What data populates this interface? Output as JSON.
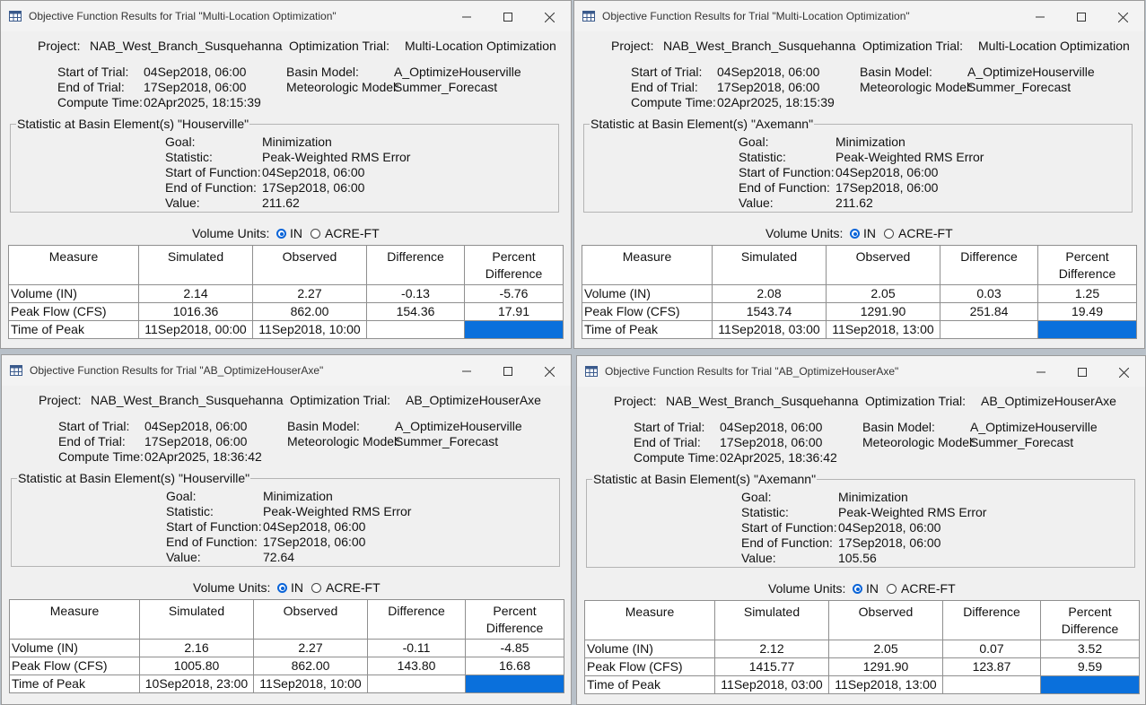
{
  "windows": [
    {
      "title": "Objective Function Results for Trial \"Multi-Location Optimization\"",
      "project_label": "Project:",
      "project": "NAB_West_Branch_Susquehanna",
      "trial_label": "Optimization Trial:",
      "trial": "Multi-Location Optimization",
      "start_label": "Start of Trial:",
      "start": "04Sep2018, 06:00",
      "end_label": "End of Trial:",
      "end": "17Sep2018, 06:00",
      "compute_label": "Compute Time:",
      "compute": "02Apr2025, 18:15:39",
      "basin_label": "Basin Model:",
      "basin": "A_OptimizeHouserville",
      "met_label": "Meteorologic Model:",
      "met": "Summer_Forecast",
      "group_title": "Statistic at Basin Element(s) \"Houserville\"",
      "goal_label": "Goal:",
      "goal": "Minimization",
      "statistic_label": "Statistic:",
      "statistic": "Peak-Weighted RMS Error",
      "fstart_label": "Start of Function:",
      "fstart": "04Sep2018, 06:00",
      "fend_label": "End of Function:",
      "fend": "17Sep2018, 06:00",
      "value_label": "Value:",
      "value": "211.62",
      "units_label": "Volume Units:",
      "unit_in": "IN",
      "unit_acre": "ACRE-FT",
      "headers": [
        "Measure",
        "Simulated",
        "Observed",
        "Difference",
        "Percent Difference"
      ],
      "rows": [
        [
          "Volume (IN)",
          "2.14",
          "2.27",
          "-0.13",
          "-5.76"
        ],
        [
          "Peak Flow (CFS)",
          "1016.36",
          "862.00",
          "154.36",
          "17.91"
        ],
        [
          "Time of Peak",
          "11Sep2018, 00:00",
          "11Sep2018, 10:00",
          "",
          ""
        ]
      ]
    },
    {
      "title": "Objective Function Results for Trial \"Multi-Location Optimization\"",
      "project_label": "Project:",
      "project": "NAB_West_Branch_Susquehanna",
      "trial_label": "Optimization Trial:",
      "trial": "Multi-Location Optimization",
      "start_label": "Start of Trial:",
      "start": "04Sep2018, 06:00",
      "end_label": "End of Trial:",
      "end": "17Sep2018, 06:00",
      "compute_label": "Compute Time:",
      "compute": "02Apr2025, 18:15:39",
      "basin_label": "Basin Model:",
      "basin": "A_OptimizeHouserville",
      "met_label": "Meteorologic Model:",
      "met": "Summer_Forecast",
      "group_title": "Statistic at Basin Element(s) \"Axemann\"",
      "goal_label": "Goal:",
      "goal": "Minimization",
      "statistic_label": "Statistic:",
      "statistic": "Peak-Weighted RMS Error",
      "fstart_label": "Start of Function:",
      "fstart": "04Sep2018, 06:00",
      "fend_label": "End of Function:",
      "fend": "17Sep2018, 06:00",
      "value_label": "Value:",
      "value": "211.62",
      "units_label": "Volume Units:",
      "unit_in": "IN",
      "unit_acre": "ACRE-FT",
      "headers": [
        "Measure",
        "Simulated",
        "Observed",
        "Difference",
        "Percent Difference"
      ],
      "rows": [
        [
          "Volume (IN)",
          "2.08",
          "2.05",
          "0.03",
          "1.25"
        ],
        [
          "Peak Flow (CFS)",
          "1543.74",
          "1291.90",
          "251.84",
          "19.49"
        ],
        [
          "Time of Peak",
          "11Sep2018, 03:00",
          "11Sep2018, 13:00",
          "",
          ""
        ]
      ]
    },
    {
      "title": "Objective Function Results for Trial \"AB_OptimizeHouserAxe\"",
      "project_label": "Project:",
      "project": "NAB_West_Branch_Susquehanna",
      "trial_label": "Optimization Trial:",
      "trial": "AB_OptimizeHouserAxe",
      "start_label": "Start of Trial:",
      "start": "04Sep2018, 06:00",
      "end_label": "End of Trial:",
      "end": "17Sep2018, 06:00",
      "compute_label": "Compute Time:",
      "compute": "02Apr2025, 18:36:42",
      "basin_label": "Basin Model:",
      "basin": "A_OptimizeHouserville",
      "met_label": "Meteorologic Model:",
      "met": "Summer_Forecast",
      "group_title": "Statistic at Basin Element(s) \"Houserville\"",
      "goal_label": "Goal:",
      "goal": "Minimization",
      "statistic_label": "Statistic:",
      "statistic": "Peak-Weighted RMS Error",
      "fstart_label": "Start of Function:",
      "fstart": "04Sep2018, 06:00",
      "fend_label": "End of Function:",
      "fend": "17Sep2018, 06:00",
      "value_label": "Value:",
      "value": "72.64",
      "units_label": "Volume Units:",
      "unit_in": "IN",
      "unit_acre": "ACRE-FT",
      "headers": [
        "Measure",
        "Simulated",
        "Observed",
        "Difference",
        "Percent Difference"
      ],
      "rows": [
        [
          "Volume (IN)",
          "2.16",
          "2.27",
          "-0.11",
          "-4.85"
        ],
        [
          "Peak Flow (CFS)",
          "1005.80",
          "862.00",
          "143.80",
          "16.68"
        ],
        [
          "Time of Peak",
          "10Sep2018, 23:00",
          "11Sep2018, 10:00",
          "",
          ""
        ]
      ]
    },
    {
      "title": "Objective Function Results for Trial \"AB_OptimizeHouserAxe\"",
      "project_label": "Project:",
      "project": "NAB_West_Branch_Susquehanna",
      "trial_label": "Optimization Trial:",
      "trial": "AB_OptimizeHouserAxe",
      "start_label": "Start of Trial:",
      "start": "04Sep2018, 06:00",
      "end_label": "End of Trial:",
      "end": "17Sep2018, 06:00",
      "compute_label": "Compute Time:",
      "compute": "02Apr2025, 18:36:42",
      "basin_label": "Basin Model:",
      "basin": "A_OptimizeHouserville",
      "met_label": "Meteorologic Model:",
      "met": "Summer_Forecast",
      "group_title": "Statistic at Basin Element(s) \"Axemann\"",
      "goal_label": "Goal:",
      "goal": "Minimization",
      "statistic_label": "Statistic:",
      "statistic": "Peak-Weighted RMS Error",
      "fstart_label": "Start of Function:",
      "fstart": "04Sep2018, 06:00",
      "fend_label": "End of Function:",
      "fend": "17Sep2018, 06:00",
      "value_label": "Value:",
      "value": "105.56",
      "units_label": "Volume Units:",
      "unit_in": "IN",
      "unit_acre": "ACRE-FT",
      "headers": [
        "Measure",
        "Simulated",
        "Observed",
        "Difference",
        "Percent Difference"
      ],
      "rows": [
        [
          "Volume (IN)",
          "2.12",
          "2.05",
          "0.07",
          "3.52"
        ],
        [
          "Peak Flow (CFS)",
          "1415.77",
          "1291.90",
          "123.87",
          "9.59"
        ],
        [
          "Time of Peak",
          "11Sep2018, 03:00",
          "11Sep2018, 13:00",
          "",
          ""
        ]
      ]
    }
  ],
  "colors": {
    "selection": "#0a70dc",
    "radio_accent": "#0a64d8",
    "window_bg": "#f0f0f0"
  }
}
